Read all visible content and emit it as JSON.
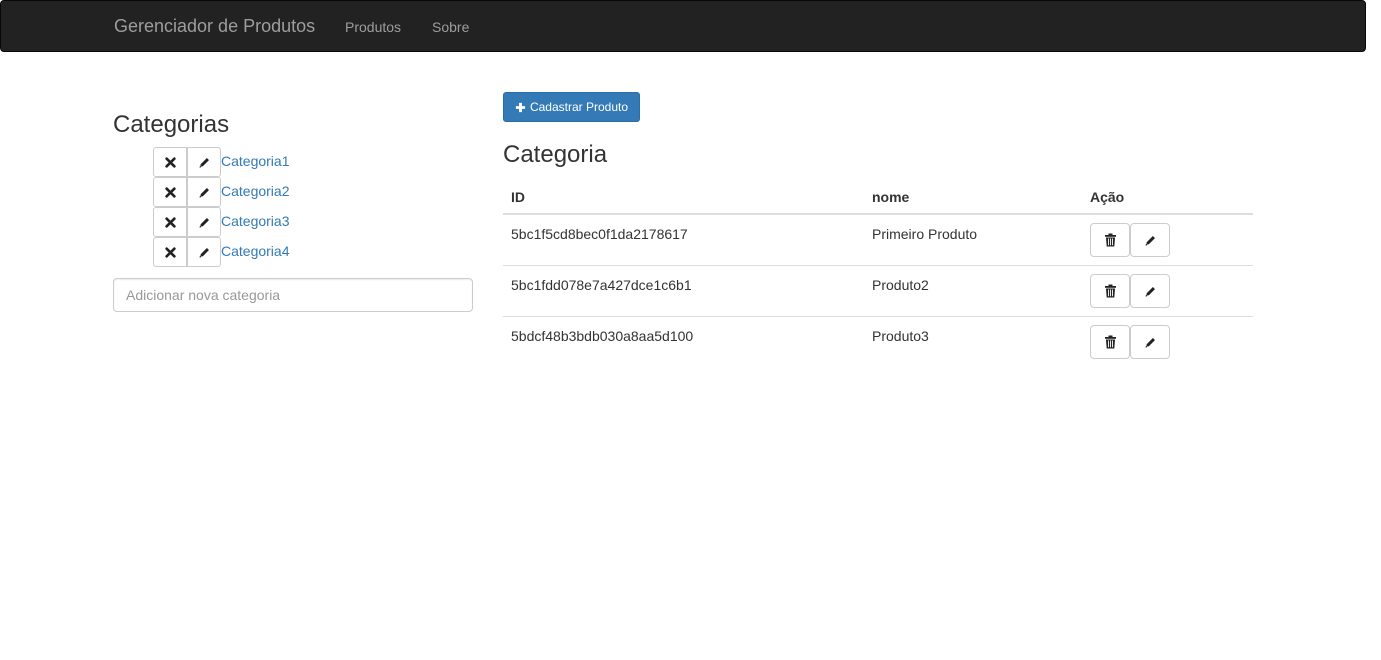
{
  "navbar": {
    "brand": "Gerenciador de Produtos",
    "links": [
      "Produtos",
      "Sobre"
    ]
  },
  "categories": {
    "title": "Categorias",
    "items": [
      {
        "label": "Categoria1",
        "delete_icon": "times-icon",
        "edit_icon": "pencil-icon"
      },
      {
        "label": "Categoria2",
        "delete_icon": "times-icon",
        "edit_icon": "pencil-icon"
      },
      {
        "label": "Categoria3",
        "delete_icon": "times-icon",
        "edit_icon": "pencil-icon"
      },
      {
        "label": "Categoria4",
        "delete_icon": "times-icon",
        "edit_icon": "pencil-icon"
      }
    ],
    "new_placeholder": "Adicionar nova categoria"
  },
  "products": {
    "add_button_label": "Cadastrar Produto",
    "add_button_icon": "plus-icon",
    "heading": "Categoria",
    "columns": [
      "ID",
      "nome",
      "Ação"
    ],
    "rows": [
      {
        "id": "5bc1f5cd8bec0f1da2178617",
        "nome": "Primeiro Produto"
      },
      {
        "id": "5bc1fdd078e7a427dce1c6b1",
        "nome": "Produto2"
      },
      {
        "id": "5bdcf48b3bdb030a8aa5d100",
        "nome": "Produto3"
      }
    ],
    "row_actions": [
      "trash-icon",
      "pencil-icon"
    ]
  },
  "colors": {
    "navbar_bg": "#222222",
    "navbar_text": "#9d9d9d",
    "link": "#337ab7",
    "primary": "#337ab7",
    "border": "#dddddd"
  }
}
